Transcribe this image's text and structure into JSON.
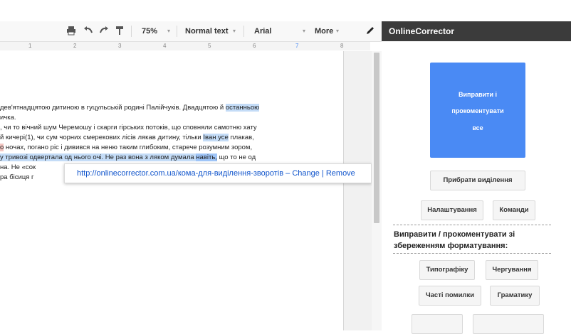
{
  "toolbar": {
    "zoom": "75%",
    "style": "Normal text",
    "font": "Arial",
    "more": "More",
    "caret": "▾",
    "icons": [
      "print-icon",
      "undo-icon",
      "redo-icon",
      "paint-format-icon",
      "pencil-icon"
    ]
  },
  "ruler": {
    "marks": [
      "1",
      "2",
      "3",
      "4",
      "5",
      "6",
      "7",
      "8"
    ]
  },
  "document": {
    "line1": {
      "a": "дев'ятнадцятою дитиною в гуцульській родині Палійчуків. Двадцятою й ",
      "b": "останньою"
    },
    "line2": "ичка.",
    "line3": ", чи то вічний шум Черемошу і скарги гірських потоків, що сповняли самотню хату",
    "line4": {
      "a": "й кичері(1), чи сум чорних смерекових лісів лякав дитину, тільки ",
      "b": "Іван усе",
      "c": " плакав,"
    },
    "line5": {
      "a": "о",
      "b": " ночах, погано ріс і дивився на неню таким глибоким, старече розумним зором,"
    },
    "line6": {
      "a": "у тривозі одвертала од нього очі. Не раз вона з ляком ",
      "b": "думала",
      "c": " ",
      "d": "навіть,",
      "e": " що то не од"
    },
    "line7": "на. Не «сок",
    "line8": "ра бісиця г"
  },
  "popup": {
    "link": "http://onlinecorrector.com.ua/кома-для-виділення-зворотів",
    "sep": "–",
    "change": "Change",
    "bar": "|",
    "remove": "Remove"
  },
  "sidebar": {
    "title": "OnlineCorrector",
    "main_button": {
      "line1": "Виправити і",
      "line2": "прокоментувати",
      "line3": "все"
    },
    "remove_selection": "Прибрати виділення",
    "settings": "Налаштування",
    "commands": "Команди",
    "section_title": "Виправити / прокоментувати зі збереженням форматування:",
    "typography": "Типографіку",
    "alternation": "Чергування",
    "common_errors": "Часті помилки",
    "grammar": "Граматику"
  }
}
